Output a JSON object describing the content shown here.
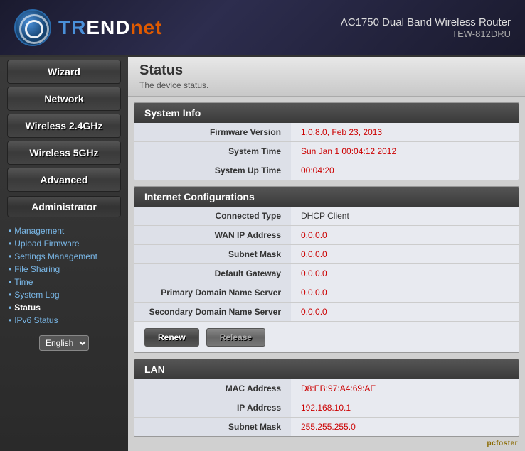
{
  "header": {
    "logo_text_tr": "TR",
    "logo_text_end": "ENDnet",
    "product_name": "AC1750 Dual Band Wireless Router",
    "product_model": "TEW-812DRU"
  },
  "sidebar": {
    "nav_items": [
      {
        "id": "wizard",
        "label": "Wizard"
      },
      {
        "id": "network",
        "label": "Network"
      },
      {
        "id": "wireless24",
        "label": "Wireless 2.4GHz"
      },
      {
        "id": "wireless5",
        "label": "Wireless 5GHz"
      },
      {
        "id": "advanced",
        "label": "Advanced"
      }
    ],
    "admin_section": "Administrator",
    "admin_links": [
      {
        "id": "management",
        "label": "Management"
      },
      {
        "id": "upload-firmware",
        "label": "Upload Firmware"
      },
      {
        "id": "settings-management",
        "label": "Settings Management"
      },
      {
        "id": "file-sharing",
        "label": "File Sharing"
      },
      {
        "id": "time",
        "label": "Time"
      },
      {
        "id": "system-log",
        "label": "System Log"
      },
      {
        "id": "status",
        "label": "Status",
        "active": true
      },
      {
        "id": "ipv6-status",
        "label": "IPv6 Status"
      }
    ],
    "lang_options": [
      "English"
    ],
    "lang_selected": "English"
  },
  "content": {
    "page_title": "Status",
    "page_subtitle": "The device status.",
    "sections": [
      {
        "id": "system-info",
        "title": "System Info",
        "rows": [
          {
            "label": "Firmware Version",
            "value": "1.0.8.0, Feb 23, 2013",
            "color": "red"
          },
          {
            "label": "System Time",
            "value": "Sun Jan 1 00:04:12 2012",
            "color": "red"
          },
          {
            "label": "System Up Time",
            "value": "00:04:20",
            "color": "red"
          }
        ]
      },
      {
        "id": "internet-config",
        "title": "Internet Configurations",
        "rows": [
          {
            "label": "Connected Type",
            "value": "DHCP Client",
            "color": "black"
          },
          {
            "label": "WAN IP Address",
            "value": "0.0.0.0",
            "color": "red"
          },
          {
            "label": "Subnet Mask",
            "value": "0.0.0.0",
            "color": "red"
          },
          {
            "label": "Default Gateway",
            "value": "0.0.0.0",
            "color": "red"
          },
          {
            "label": "Primary Domain Name Server",
            "value": "0.0.0.0",
            "color": "red"
          },
          {
            "label": "Secondary Domain Name Server",
            "value": "0.0.0.0",
            "color": "red"
          }
        ],
        "buttons": [
          {
            "id": "renew",
            "label": "Renew",
            "disabled": false
          },
          {
            "id": "release",
            "label": "Release",
            "disabled": true
          }
        ]
      },
      {
        "id": "lan",
        "title": "LAN",
        "rows": [
          {
            "label": "MAC Address",
            "value": "D8:EB:97:A4:69:AE",
            "color": "red"
          },
          {
            "label": "IP Address",
            "value": "192.168.10.1",
            "color": "red"
          },
          {
            "label": "Subnet Mask",
            "value": "255.255.255.0",
            "color": "red"
          }
        ]
      }
    ]
  },
  "watermark": "pcfoster"
}
